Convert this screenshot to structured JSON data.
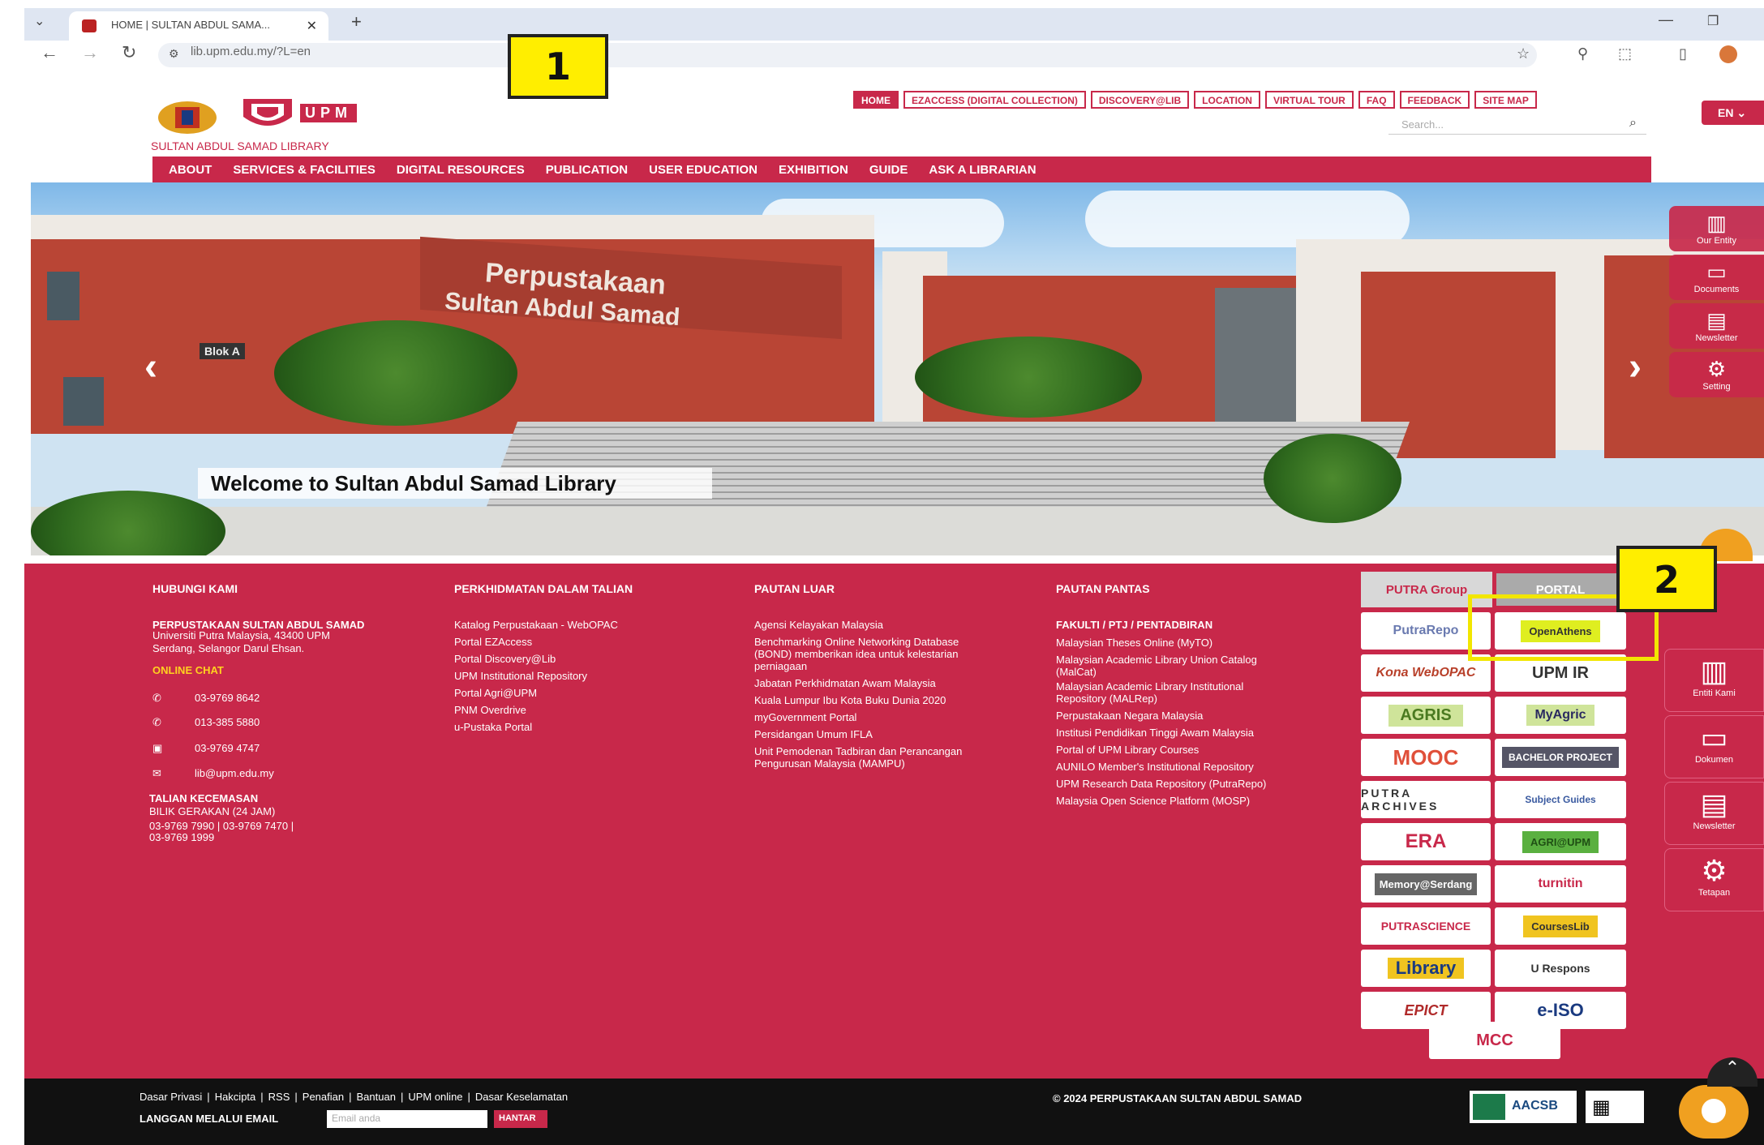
{
  "browser": {
    "tab_title": "HOME | SULTAN ABDUL SAMA...",
    "url": "lib.upm.edu.my/?L=en"
  },
  "callouts": [
    "1",
    "2"
  ],
  "header": {
    "library_name": "SULTAN ABDUL SAMAD LIBRARY",
    "upm_text": "UPM",
    "search_placeholder": "Search...",
    "lang": "EN"
  },
  "topnav": [
    "HOME",
    "EZACCESS (DIGITAL COLLECTION)",
    "DISCOVERY@LIB",
    "LOCATION",
    "VIRTUAL TOUR",
    "FAQ",
    "FEEDBACK",
    "SITE MAP"
  ],
  "mainnav": [
    "ABOUT",
    "SERVICES & FACILITIES",
    "DIGITAL RESOURCES",
    "PUBLICATION",
    "USER EDUCATION",
    "EXHIBITION",
    "GUIDE",
    "ASK A LIBRARIAN"
  ],
  "hero": {
    "sign1": "Perpustakaan",
    "sign2": "Sultan Abdul Samad",
    "blok": "Blok A",
    "caption": "Welcome to Sultan Abdul Samad Library"
  },
  "hero_side": [
    "Our Entity",
    "Documents",
    "Newsletter",
    "Setting"
  ],
  "footer_side": [
    "Entiti Kami",
    "Dokumen",
    "Newsletter",
    "Tetapan"
  ],
  "footer": {
    "col1": {
      "title": "HUBUNGI KAMI",
      "name": "PERPUSTAKAAN SULTAN ABDUL SAMAD",
      "addr1": "Universiti Putra Malaysia, 43400 UPM",
      "addr2": "Serdang, Selangor Darul Ehsan.",
      "chat": "ONLINE CHAT",
      "tel1": "03-9769 8642",
      "tel2": "013-385 5880",
      "fax": "03-9769 4747",
      "email": "lib@upm.edu.my",
      "emerg_title": "TALIAN KECEMASAN",
      "emerg1": "BILIK GERAKAN (24 JAM)",
      "emerg2": "03-9769 7990 | 03-9769 7470 |",
      "emerg3": "03-9769 1999"
    },
    "col2": {
      "title": "PERKHIDMATAN DALAM TALIAN",
      "items": [
        "Katalog Perpustakaan - WebOPAC",
        "Portal EZAccess",
        "Portal Discovery@Lib",
        "UPM Institutional Repository",
        "Portal Agri@UPM",
        "PNM Overdrive",
        "u-Pustaka Portal"
      ]
    },
    "col3": {
      "title": "PAUTAN LUAR",
      "items": [
        "Agensi Kelayakan Malaysia",
        "Benchmarking Online Networking Database",
        "(BOND) memberikan idea untuk kelestarian",
        "perniagaan",
        "Jabatan Perkhidmatan Awam Malaysia",
        "Kuala Lumpur Ibu Kota Buku Dunia 2020",
        "myGovernment Portal",
        "Persidangan Umum IFLA",
        "Unit Pemodenan Tadbiran dan Perancangan",
        "Pengurusan Malaysia (MAMPU)"
      ]
    },
    "col4": {
      "title": "PAUTAN PANTAS",
      "subtitle": "FAKULTI / PTJ / PENTADBIRAN",
      "items": [
        "Malaysian Theses Online (MyTO)",
        "Malaysian Academic Library Union Catalog",
        "(MalCat)",
        "Malaysian Academic Library Institutional",
        "Repository (MALRep)",
        "Perpustakaan Negara Malaysia",
        "Institusi Pendidikan Tinggi Awam Malaysia",
        "Portal of UPM Library Courses",
        "AUNILO Member's Institutional Repository",
        "UPM Research Data Repository (PutraRepo)",
        "Malaysia Open Science Platform (MOSP)"
      ]
    },
    "portal_tabs": [
      "PUTRA Group",
      "PORTAL"
    ],
    "portal_left": [
      "PutraRepo",
      "Kona WebOPAC",
      "AGRIS",
      "MOOC",
      "PUTRA ARCHIVES",
      "ERA",
      "Memory@Serdang",
      "PUTRASCIENCE",
      "Library",
      "EPICT"
    ],
    "portal_right": [
      "OpenAthens",
      "UPM IR",
      "MyAgric",
      "BACHELOR PROJECT",
      "Subject Guides",
      "AGRI@UPM",
      "turnitin",
      "CoursesLib",
      "U Respons",
      "e-ISO"
    ],
    "portal_bottom": "MCC"
  },
  "bottom": {
    "links": [
      "Dasar Privasi",
      "Hakcipta",
      "RSS",
      "Penafian",
      "Bantuan",
      "UPM online",
      "Dasar Keselamatan"
    ],
    "subscribe": "LANGGAN MELALUI EMAIL",
    "email_ph": "Email anda",
    "send": "HANTAR",
    "copyright": "© 2024 PERPUSTAKAAN SULTAN ABDUL SAMAD",
    "aacsb": "AACSB"
  },
  "colors": {
    "primary": "#c8284a",
    "callout": "#ffee00",
    "dark": "#111111"
  }
}
